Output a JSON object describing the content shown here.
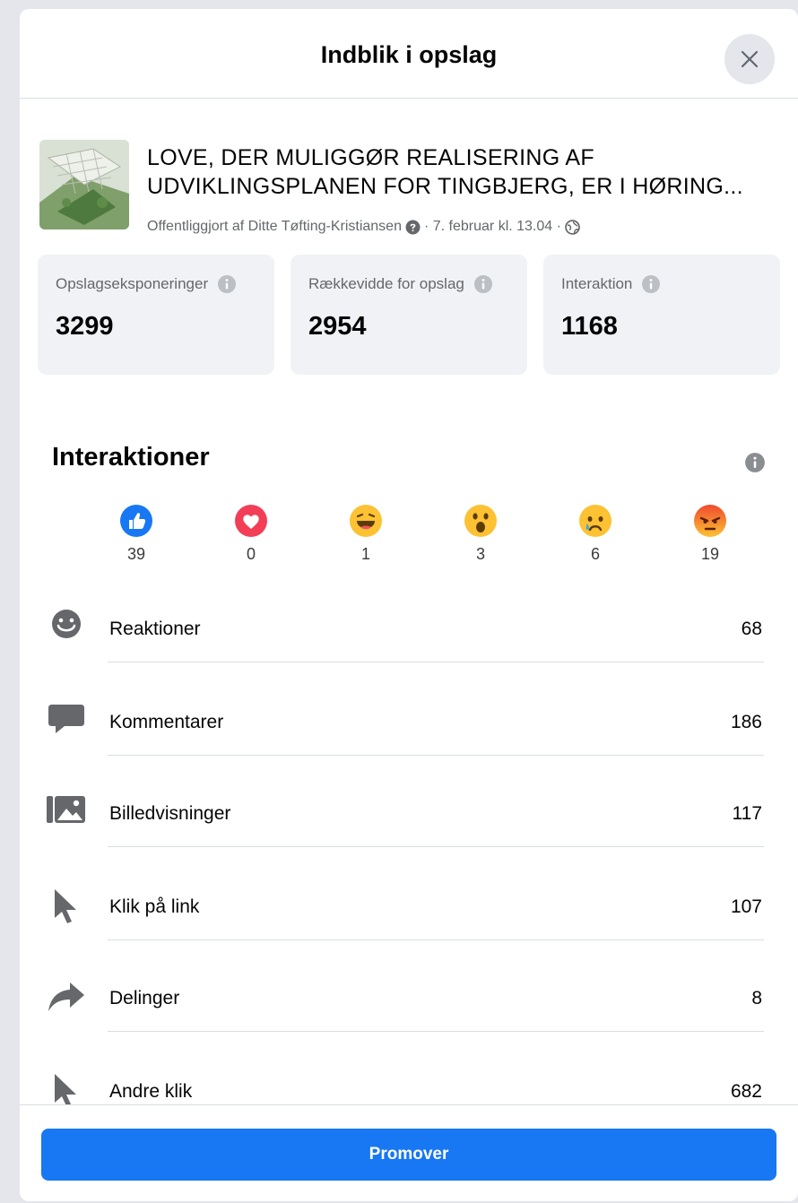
{
  "header": {
    "title": "Indblik i opslag"
  },
  "post": {
    "title": "LOVE, DER MULIGGØR REALISERING AF UDVIKLINGSPLANEN FOR TINGBJERG, ER I HØRING...",
    "meta_text": "Offentliggjort af Ditte Tøfting-Kristiansen",
    "meta_date": "· 7. februar kl. 13.04 ·"
  },
  "stats": [
    {
      "label": "Opslagseksponeringer",
      "value": "3299"
    },
    {
      "label": "Rækkevidde for opslag",
      "value": "2954"
    },
    {
      "label": "Interaktion",
      "value": "1168"
    }
  ],
  "section": {
    "title": "Interaktioner"
  },
  "reactions": [
    {
      "icon": "like-icon",
      "count": "39"
    },
    {
      "icon": "love-icon",
      "count": "0"
    },
    {
      "icon": "haha-icon",
      "count": "1"
    },
    {
      "icon": "wow-icon",
      "count": "3"
    },
    {
      "icon": "sad-icon",
      "count": "6"
    },
    {
      "icon": "angry-icon",
      "count": "19"
    }
  ],
  "metrics": [
    {
      "icon": "smiley-icon",
      "label": "Reaktioner",
      "value": "68"
    },
    {
      "icon": "comment-icon",
      "label": "Kommentarer",
      "value": "186"
    },
    {
      "icon": "photo-icon",
      "label": "Billedvisninger",
      "value": "117"
    },
    {
      "icon": "cursor-icon",
      "label": "Klik på link",
      "value": "107"
    },
    {
      "icon": "share-icon",
      "label": "Delinger",
      "value": "8"
    },
    {
      "icon": "cursor-icon",
      "label": "Andre klik",
      "value": "682"
    }
  ],
  "footer": {
    "promote_label": "Promover"
  },
  "colors": {
    "accent": "#1877f2",
    "card_bg": "#f0f2f5",
    "muted_text": "#65676b",
    "like": "#1877f2",
    "love": "#f33e58",
    "emoji": "#fcc233",
    "angry": "#e9710f"
  }
}
